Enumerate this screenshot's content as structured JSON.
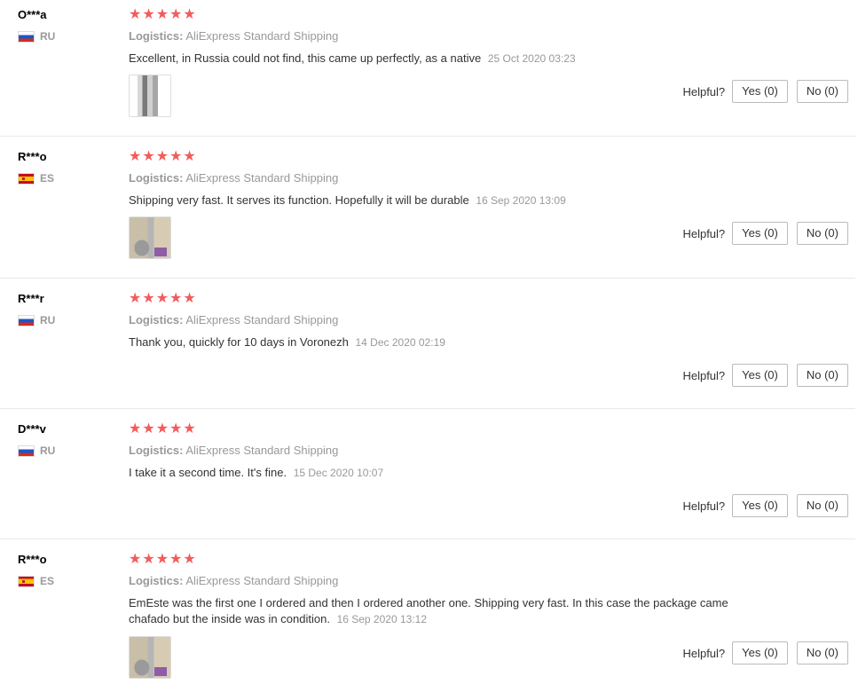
{
  "reviews": [
    {
      "user": "O***a",
      "country": "RU",
      "stars": "★★★★★",
      "logistics_label": "Logistics:",
      "logistics_value": "AliExpress Standard Shipping",
      "text": "Excellent, in Russia could not find, this came up perfectly, as a native",
      "date": "25 Oct 2020 03:23",
      "helpful_label": "Helpful?",
      "yes_label": "Yes (0)",
      "no_label": "No (0)"
    },
    {
      "user": "R***o",
      "country": "ES",
      "stars": "★★★★★",
      "logistics_label": "Logistics:",
      "logistics_value": "AliExpress Standard Shipping",
      "text": "Shipping very fast. It serves its function. Hopefully it will be durable",
      "date": "16 Sep 2020 13:09",
      "helpful_label": "Helpful?",
      "yes_label": "Yes (0)",
      "no_label": "No (0)"
    },
    {
      "user": "R***r",
      "country": "RU",
      "stars": "★★★★★",
      "logistics_label": "Logistics:",
      "logistics_value": "AliExpress Standard Shipping",
      "text": "Thank you, quickly for 10 days in Voronezh",
      "date": "14 Dec 2020 02:19",
      "helpful_label": "Helpful?",
      "yes_label": "Yes (0)",
      "no_label": "No (0)"
    },
    {
      "user": "D***v",
      "country": "RU",
      "stars": "★★★★★",
      "logistics_label": "Logistics:",
      "logistics_value": "AliExpress Standard Shipping",
      "text": "I take it a second time. It's fine.",
      "date": "15 Dec 2020 10:07",
      "helpful_label": "Helpful?",
      "yes_label": "Yes (0)",
      "no_label": "No (0)"
    },
    {
      "user": "R***o",
      "country": "ES",
      "stars": "★★★★★",
      "logistics_label": "Logistics:",
      "logistics_value": "AliExpress Standard Shipping",
      "text": "EmEste was the first one I ordered and then I ordered another one. Shipping very fast. In this case the package came chafado but the inside was in condition.",
      "date": "16 Sep 2020 13:12",
      "helpful_label": "Helpful?",
      "yes_label": "Yes (0)",
      "no_label": "No (0)"
    }
  ],
  "colors": {
    "star": "#f25c5c",
    "muted": "#999999",
    "divider": "#e8e8e8"
  }
}
